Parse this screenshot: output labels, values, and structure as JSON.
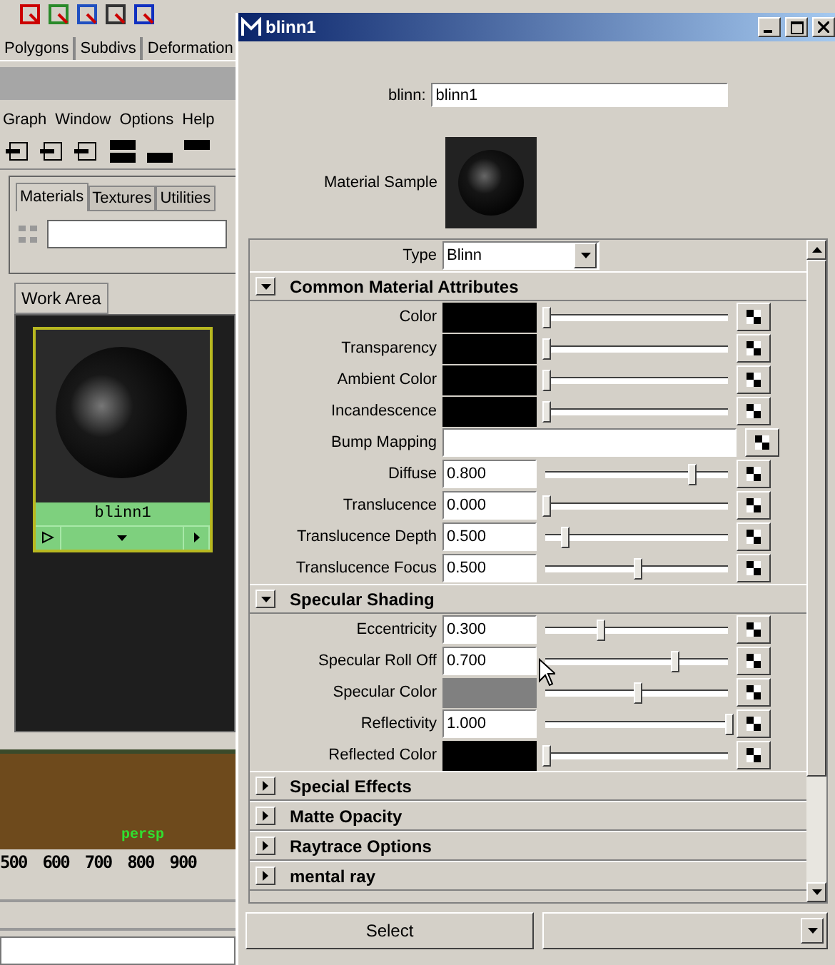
{
  "background": {
    "shelf_tabs": [
      "Polygons",
      "Subdivs",
      "Deformation"
    ],
    "menu": [
      "Graph",
      "Window",
      "Options",
      "Help"
    ],
    "panel_tabs": [
      {
        "label": "Materials",
        "selected": true
      },
      {
        "label": "Textures",
        "selected": false
      },
      {
        "label": "Utilities",
        "selected": false
      }
    ],
    "work_area_tab": "Work Area",
    "node": {
      "label": "blinn1"
    },
    "viewport_label": "persp",
    "ruler": [
      "500",
      "600",
      "700",
      "800",
      "900"
    ]
  },
  "window": {
    "title": "blinn1"
  },
  "name_field": {
    "label": "blinn:",
    "value": "blinn1"
  },
  "material_sample": {
    "label": "Material Sample"
  },
  "type_field": {
    "label": "Type",
    "value": "Blinn"
  },
  "sections": [
    {
      "title": "Common Material Attributes",
      "expanded": true,
      "rows": [
        {
          "kind": "color",
          "label": "Color",
          "color": "#000000",
          "level": 0
        },
        {
          "kind": "color",
          "label": "Transparency",
          "color": "#000000",
          "level": 0
        },
        {
          "kind": "color",
          "label": "Ambient Color",
          "color": "#000000",
          "level": 0
        },
        {
          "kind": "color",
          "label": "Incandescence",
          "color": "#000000",
          "level": 0
        },
        {
          "kind": "map",
          "label": "Bump Mapping"
        },
        {
          "kind": "number",
          "label": "Diffuse",
          "value": "0.800",
          "level": 0.8
        },
        {
          "kind": "number",
          "label": "Translucence",
          "value": "0.000",
          "level": 0
        },
        {
          "kind": "number",
          "label": "Translucence Depth",
          "value": "0.500",
          "level": 0.1
        },
        {
          "kind": "number",
          "label": "Translucence Focus",
          "value": "0.500",
          "level": 0.5
        }
      ]
    },
    {
      "title": "Specular Shading",
      "expanded": true,
      "rows": [
        {
          "kind": "number",
          "label": "Eccentricity",
          "value": "0.300",
          "level": 0.3
        },
        {
          "kind": "number",
          "label": "Specular Roll Off",
          "value": "0.700",
          "level": 0.7
        },
        {
          "kind": "color",
          "label": "Specular Color",
          "color": "#808080",
          "level": 0.5
        },
        {
          "kind": "number",
          "label": "Reflectivity",
          "value": "1.000",
          "level": 1
        },
        {
          "kind": "color",
          "label": "Reflected Color",
          "color": "#000000",
          "level": 0
        }
      ]
    },
    {
      "title": "Special Effects",
      "expanded": false
    },
    {
      "title": "Matte Opacity",
      "expanded": false
    },
    {
      "title": "Raytrace Options",
      "expanded": false
    },
    {
      "title": "mental ray",
      "expanded": false
    }
  ],
  "buttons": [
    {
      "label": "Select"
    }
  ]
}
